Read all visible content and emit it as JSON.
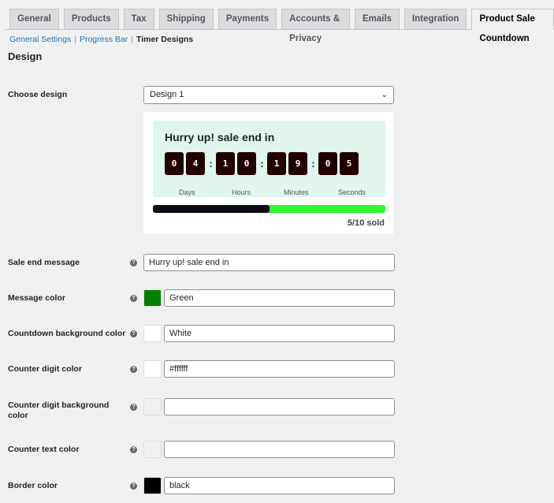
{
  "tabs": [
    "General",
    "Products",
    "Tax",
    "Shipping",
    "Payments",
    "Accounts & Privacy",
    "Emails",
    "Integration",
    "Product Sale Countdown"
  ],
  "active_tab": "Product Sale Countdown",
  "subnav": {
    "general": "General Settings",
    "progress": "Progress Bar",
    "timer": "Timer Designs",
    "sep": "|"
  },
  "section_title": "Design",
  "choose_design": {
    "label": "Choose design",
    "value": "Design 1",
    "icon": "chevron-down-icon"
  },
  "preview": {
    "title": "Hurry up! sale end in",
    "days": [
      "0",
      "4"
    ],
    "hours": [
      "1",
      "0"
    ],
    "minutes": [
      "1",
      "9"
    ],
    "seconds": [
      "0",
      "5"
    ],
    "colon": ":",
    "units": [
      "Days",
      "Hours",
      "Minutes",
      "Seconds"
    ],
    "progress_percent": 50,
    "sold": "5/10 sold"
  },
  "fields": [
    {
      "label": "Sale end message",
      "value": "Hurry up! sale end in"
    },
    {
      "label": "Message color",
      "value": "Green",
      "swatch": "#008000"
    },
    {
      "label": "Countdown background color",
      "value": "White",
      "swatch": "#ffffff"
    },
    {
      "label": "Counter digit color",
      "value": "#ffffff",
      "swatch": "#ffffff"
    },
    {
      "label": "Counter digit background color",
      "value": "",
      "swatch": "#f0f0f1"
    },
    {
      "label": "Counter text color",
      "value": "",
      "swatch": "#f0f0f1"
    },
    {
      "label": "Border color",
      "value": "black",
      "swatch": "#000000"
    }
  ],
  "help_glyph": "?"
}
